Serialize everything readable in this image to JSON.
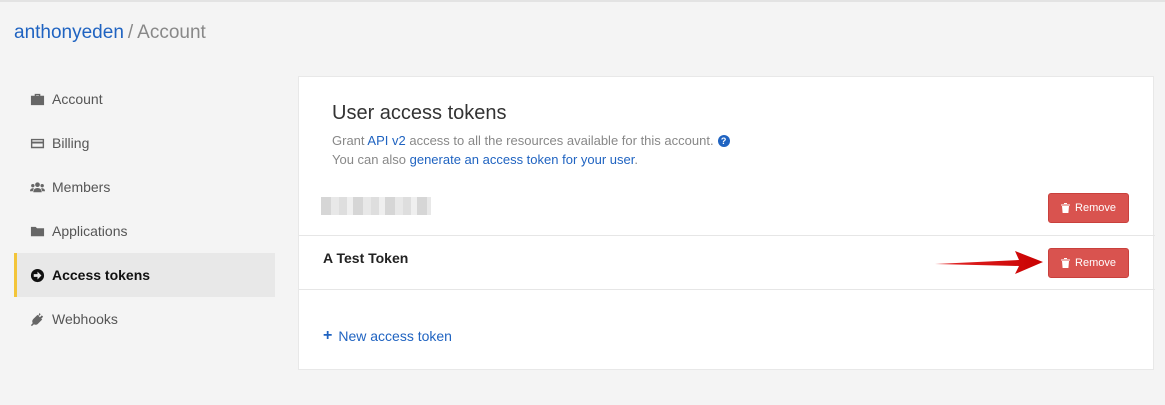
{
  "breadcrumb": {
    "owner": "anthonyeden",
    "separator": "/",
    "current": "Account"
  },
  "sidebar": {
    "items": [
      {
        "label": "Account",
        "icon": "briefcase-icon"
      },
      {
        "label": "Billing",
        "icon": "credit-card-icon"
      },
      {
        "label": "Members",
        "icon": "users-icon"
      },
      {
        "label": "Applications",
        "icon": "folder-icon"
      },
      {
        "label": "Access tokens",
        "icon": "circle-arrow-right-icon",
        "active": true
      },
      {
        "label": "Webhooks",
        "icon": "plug-icon"
      }
    ]
  },
  "panel": {
    "title": "User access tokens",
    "desc1_prefix": "Grant",
    "desc1_link": "API v2",
    "desc1_suffix": "access to all the resources available for this account.",
    "help_glyph": "?",
    "desc2_prefix": "You can also",
    "desc2_link": "generate an access token for your user",
    "desc2_suffix": "."
  },
  "tokens": [
    {
      "name": "",
      "remove_label": "Remove"
    },
    {
      "name": "A Test Token",
      "remove_label": "Remove"
    }
  ],
  "new_token": {
    "plus": "+",
    "label": "New access token"
  },
  "colors": {
    "accent": "#1f63c1",
    "danger": "#d9534f",
    "active_border": "#f3c53a",
    "annotation_arrow": "#e01010"
  }
}
